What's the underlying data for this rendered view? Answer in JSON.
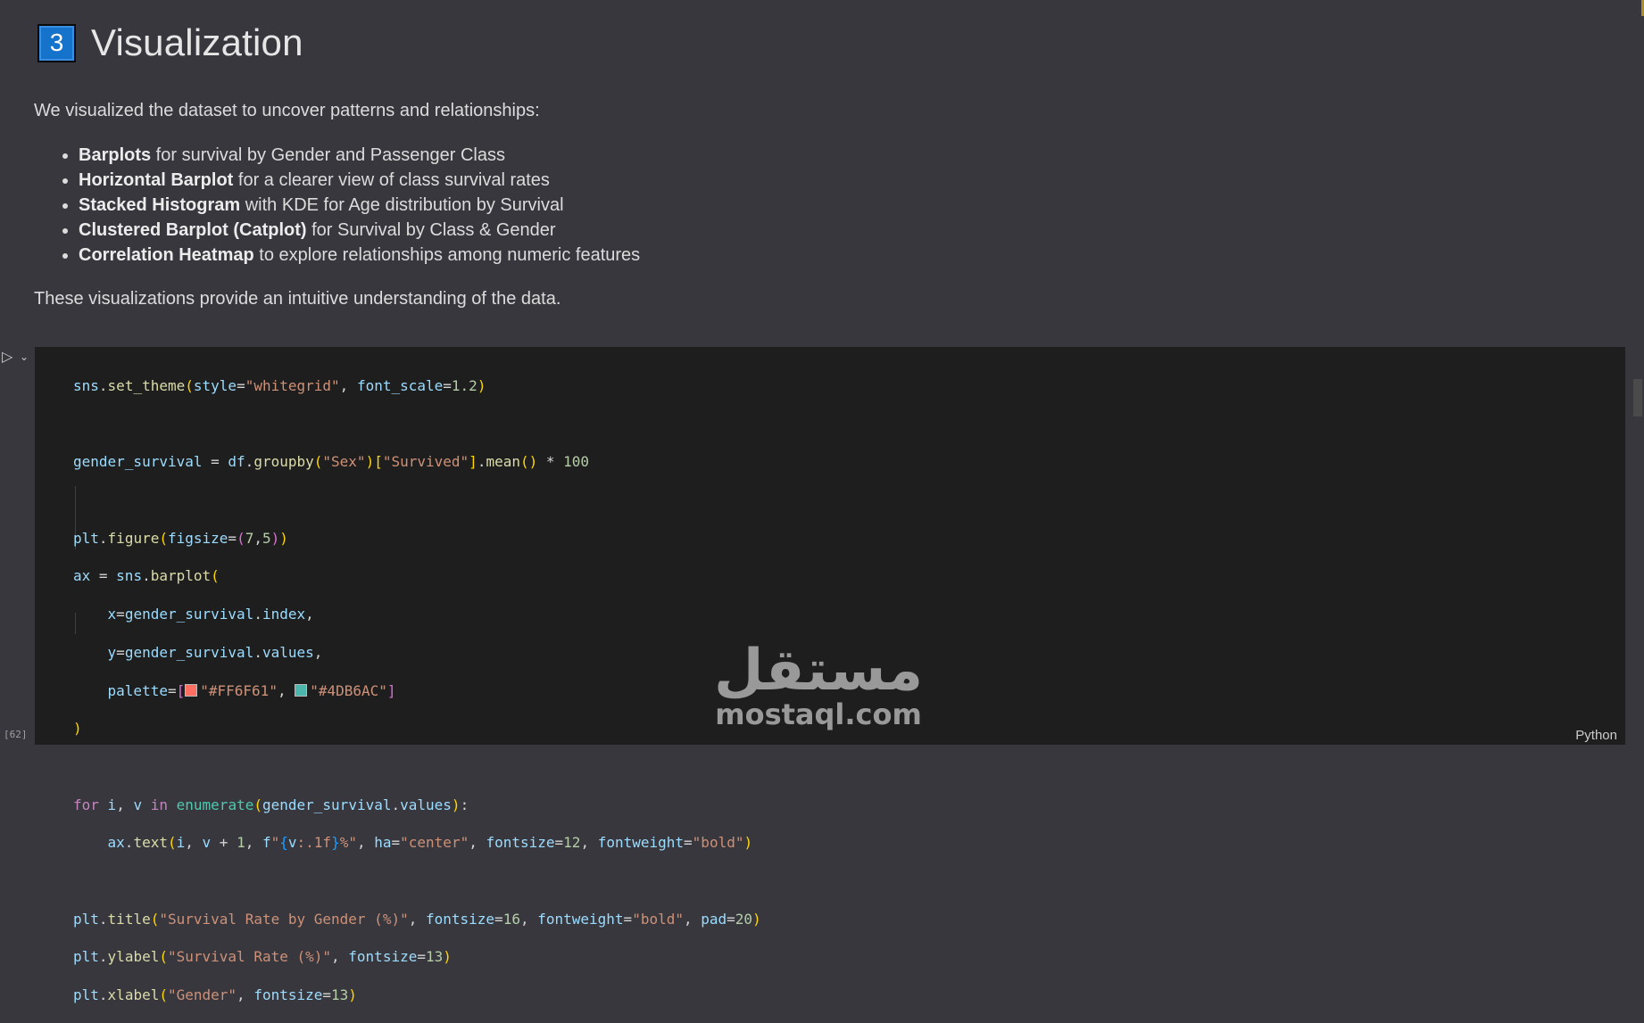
{
  "markdown": {
    "section_number": "3",
    "title": "Visualization",
    "intro": "We visualized the dataset to uncover patterns and relationships:",
    "bullets": [
      {
        "bold": "Barplots",
        "rest": " for survival by Gender and Passenger Class"
      },
      {
        "bold": "Horizontal Barplot",
        "rest": " for a clearer view of class survival rates"
      },
      {
        "bold": "Stacked Histogram",
        "rest": " with KDE for Age distribution by Survival"
      },
      {
        "bold": "Clustered Barplot (Catplot)",
        "rest": " for Survival by Class & Gender"
      },
      {
        "bold": "Correlation Heatmap",
        "rest": " to explore relationships among numeric features"
      }
    ],
    "outro": "These visualizations provide an intuitive understanding of the data."
  },
  "code_cell": {
    "execution_count": "[62]",
    "language": "Python",
    "run_icon": "play-icon",
    "collapse_icon": "chevron-down-icon"
  },
  "swatches": {
    "red": "#FF6F61",
    "teal": "#4DB6AC"
  },
  "watermark": {
    "arabic": "مستقل",
    "latin": "mostaql.com"
  }
}
